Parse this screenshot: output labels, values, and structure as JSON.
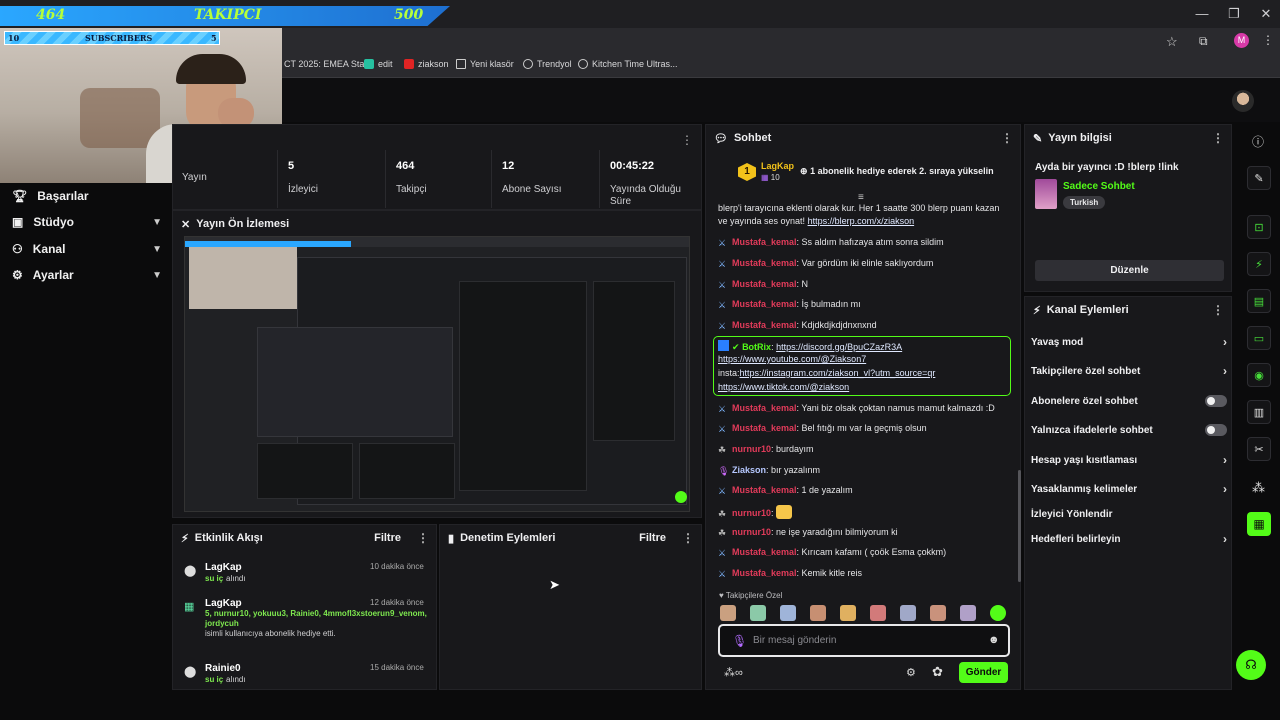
{
  "overlay": {
    "follower_goal": {
      "current": "464",
      "label": "TAKIPCI",
      "target": "500"
    },
    "subs_goal": {
      "current": "10",
      "label": "SUBSCRIBERS",
      "target": "5"
    }
  },
  "bookmarks": [
    {
      "label": "CT 2025: EMEA Sta..."
    },
    {
      "label": "edit"
    },
    {
      "label": "ziakson"
    },
    {
      "label": "Yeni klasör"
    },
    {
      "label": "Trendyol"
    },
    {
      "label": "Kitchen Time Ultras..."
    }
  ],
  "profile_initial": "M",
  "nav": {
    "items": [
      {
        "label": "Başarılar",
        "icon": "trophy-icon"
      },
      {
        "label": "Stüdyo",
        "icon": "video-icon"
      },
      {
        "label": "Kanal",
        "icon": "people-icon"
      },
      {
        "label": "Ayarlar",
        "icon": "gear-icon"
      }
    ]
  },
  "stats": [
    {
      "value": "",
      "label": "Yayın"
    },
    {
      "value": "5",
      "label": "İzleyici"
    },
    {
      "value": "464",
      "label": "Takipçi"
    },
    {
      "value": "12",
      "label": "Abone Sayısı"
    },
    {
      "value": "00:45:22",
      "label": "Yayında Olduğu Süre"
    }
  ],
  "preview": {
    "title": "Yayın Ön İzlemesi"
  },
  "activity": {
    "title": "Etkinlik Akışı",
    "filter": "Filtre",
    "items": [
      {
        "name": "LagKap",
        "highlight": "su iç",
        "desc": "alındı",
        "time": "10 dakika önce"
      },
      {
        "name": "LagKap",
        "highlight": "5, nurnur10, yokuuu3, Rainie0, 4mmofl3xstoerun9_venom, jordycuh",
        "desc": "isimli kullanıcıya abonelik hediye etti.",
        "time": "12 dakika önce"
      },
      {
        "name": "Rainie0",
        "highlight": "su iç",
        "desc": "alındı",
        "time": "15 dakika önce"
      }
    ]
  },
  "moderation": {
    "title": "Denetim Eylemleri",
    "filter": "Filtre"
  },
  "chat": {
    "title": "Sohbet",
    "pinned": {
      "rank": "1",
      "user": "LagKap",
      "sub_count": "10",
      "text": "1 abonelik hediye ederek 2. sıraya yükselin"
    },
    "messages": [
      {
        "user": "",
        "text": "blerp'i tarayıcına eklenti olarak kur. Her 1 saatte 300 blerp puanı kazan",
        "color": ""
      },
      {
        "user": "",
        "text": "ve yayında ses oynat! ",
        "link": "https://blerp.com/x/ziakson",
        "color": ""
      },
      {
        "user": "Mustafa_kemal",
        "text": "Ss aldım hafızaya atım sonra sildim",
        "color": "red"
      },
      {
        "user": "Mustafa_kemal",
        "text": "Var gördüm iki elinle saklıyordum",
        "color": "red"
      },
      {
        "user": "Mustafa_kemal",
        "text": "N",
        "color": "red"
      },
      {
        "user": "Mustafa_kemal",
        "text": "İş bulmadın mı",
        "color": "red"
      },
      {
        "user": "Mustafa_kemal",
        "text": "Kdjdkdjkdjdnxnxnd",
        "color": "red"
      }
    ],
    "bot": {
      "user": "BotRix",
      "line1": "https://discord.gg/BpuCZazR3A",
      "line2": "https://www.youtube.com/@Ziakson7",
      "line3_prefix": "insta:",
      "line3": "https://instagram.com/ziakson_vl?utm_source=qr",
      "line4": "https://www.tiktok.com/@ziakson"
    },
    "messages2": [
      {
        "user": "Mustafa_kemal",
        "text": "Yani biz olsak çoktan namus mamut kalmazdı :D",
        "color": "red"
      },
      {
        "user": "Mustafa_kemal",
        "text": "Bel fıtığı mı var la geçmiş olsun",
        "color": "red"
      },
      {
        "user": "nurnur10",
        "text": "burdayım",
        "color": "red"
      },
      {
        "user": "Ziakson",
        "text": "bır yazalınm",
        "color": "purple"
      },
      {
        "user": "Mustafa_kemal",
        "text": "1 de yazalım",
        "color": "red"
      },
      {
        "user": "nurnur10",
        "text": "",
        "color": "red"
      },
      {
        "user": "nurnur10",
        "text": "ne işe yaradığını bilmiyorum ki",
        "color": "red"
      },
      {
        "user": "Mustafa_kemal",
        "text": "Kırıcam kafamı ( çoök Esma çokkm)",
        "color": "red"
      },
      {
        "user": "Mustafa_kemal",
        "text": "Kemik kitle reis",
        "color": "red"
      }
    ],
    "followers_only_label": "Takipçilere Özel",
    "input_placeholder": "Bir mesaj gönderin",
    "send_label": "Gönder"
  },
  "stream_info": {
    "title": "Yayın bilgisi",
    "stream_title": "Ayda bir yayıncı :D !blerp !link",
    "category": "Sadece Sohbet",
    "tag": "Turkish",
    "edit_label": "Düzenle"
  },
  "channel_actions": {
    "title": "Kanal Eylemleri",
    "items": [
      {
        "label": "Yavaş mod",
        "kind": "chevron"
      },
      {
        "label": "Takipçilere özel sohbet",
        "kind": "chevron"
      },
      {
        "label": "Abonelere özel sohbet",
        "kind": "toggle"
      },
      {
        "label": "Yalnızca ifadelerle sohbet",
        "kind": "toggle"
      },
      {
        "label": "Hesap yaşı kısıtlaması",
        "kind": "chevron"
      },
      {
        "label": "Yasaklanmış kelimeler",
        "kind": "chevron"
      },
      {
        "label": "İzleyici Yönlendir",
        "kind": "none"
      },
      {
        "label": "Hedefleri belirleyin",
        "kind": "chevron"
      }
    ]
  },
  "colors": {
    "accent": "#53fc18",
    "mod_red": "#e13b5a",
    "panel": "#18181b"
  }
}
